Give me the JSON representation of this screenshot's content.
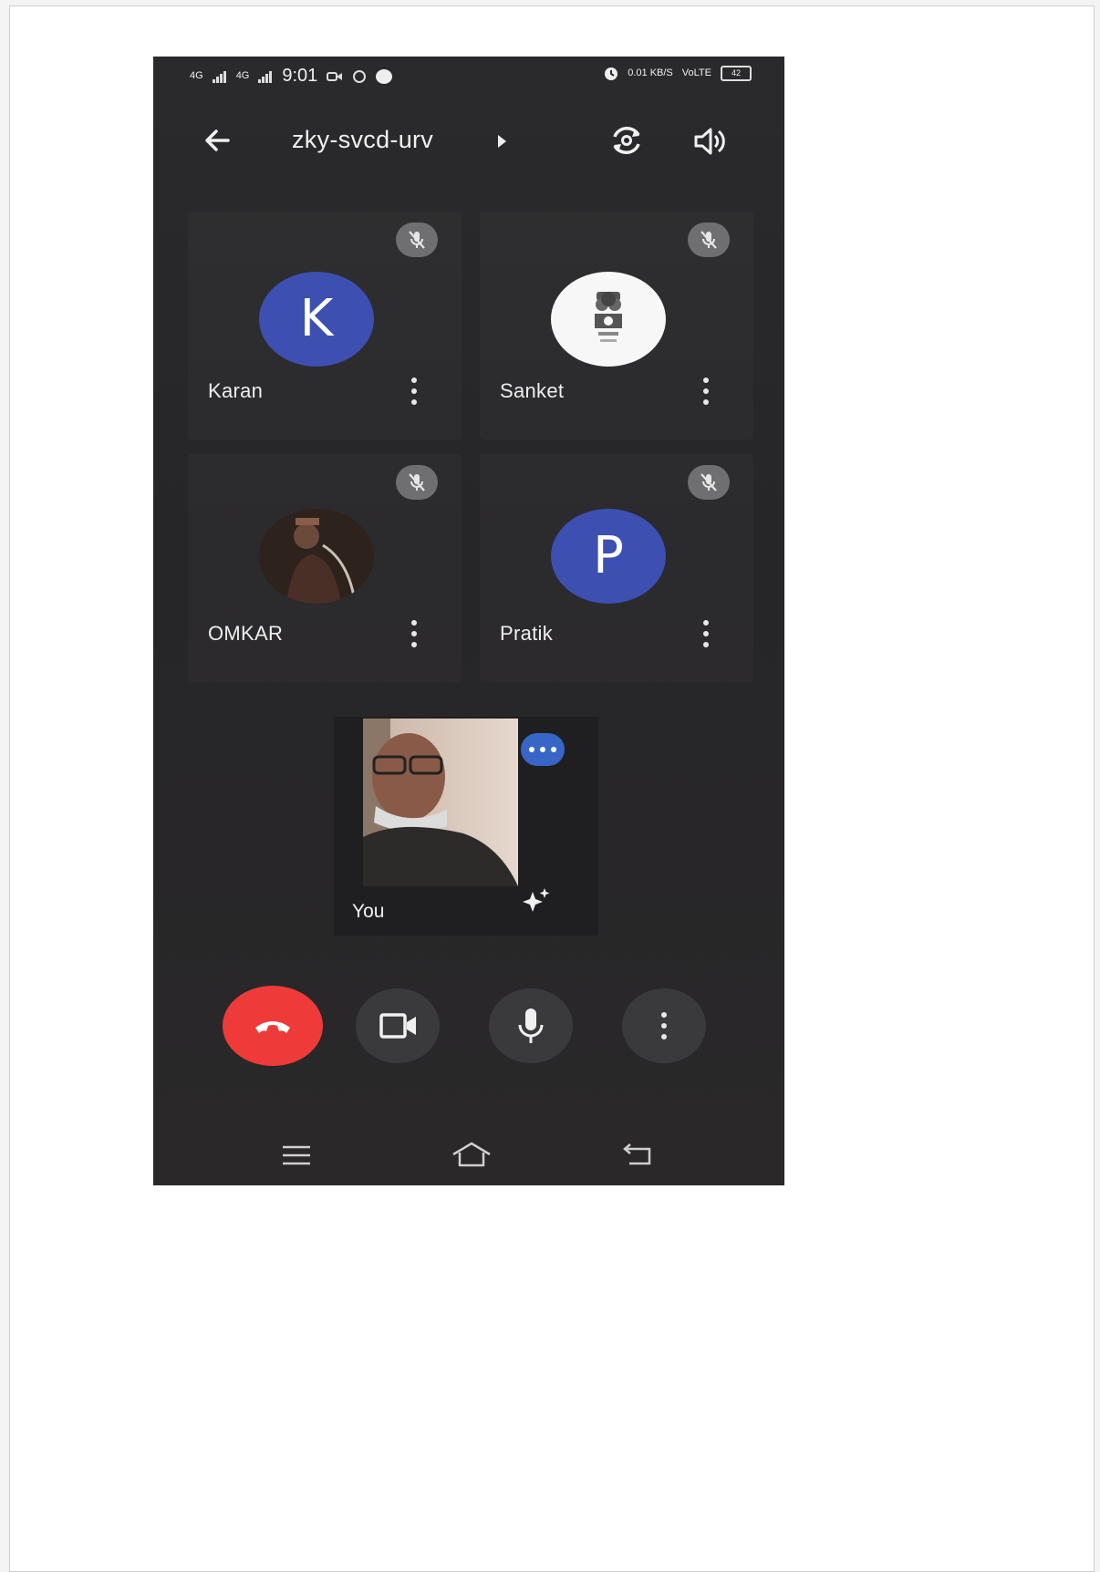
{
  "status_bar": {
    "signal_1": "4G",
    "signal_2": "4G",
    "time": "9:01",
    "net_speed": "0.01 KB/S",
    "net_type": "VoLTE",
    "battery": "42"
  },
  "top_bar": {
    "meeting_code": "zky-svcd-urv",
    "back_icon": "arrow-left-icon",
    "switch_camera_icon": "camera-switch-icon",
    "speaker_icon": "speaker-icon"
  },
  "participants": [
    {
      "name": "Karan",
      "avatar_letter": "K",
      "avatar_color": "#3d4fb0",
      "muted": true
    },
    {
      "name": "Sanket",
      "avatar_letter": "",
      "avatar_color": "#f7f7f7",
      "muted": true,
      "avatar_type": "emblem"
    },
    {
      "name": "OMKAR",
      "avatar_letter": "",
      "avatar_color": "#3b2a24",
      "muted": true,
      "avatar_type": "photo"
    },
    {
      "name": "Pratik",
      "avatar_letter": "P",
      "avatar_color": "#3d4fb0",
      "muted": true
    }
  ],
  "self_view": {
    "label": "You",
    "badge_color": "#3766c7",
    "effects_icon": "sparkle-icon"
  },
  "controls": {
    "end_call_color": "#ee3b39",
    "items": [
      "end-call-icon",
      "video-camera-icon",
      "microphone-icon",
      "more-vert-icon"
    ]
  },
  "nav_bar": {
    "items": [
      "menu-icon",
      "home-icon",
      "back-icon"
    ]
  }
}
